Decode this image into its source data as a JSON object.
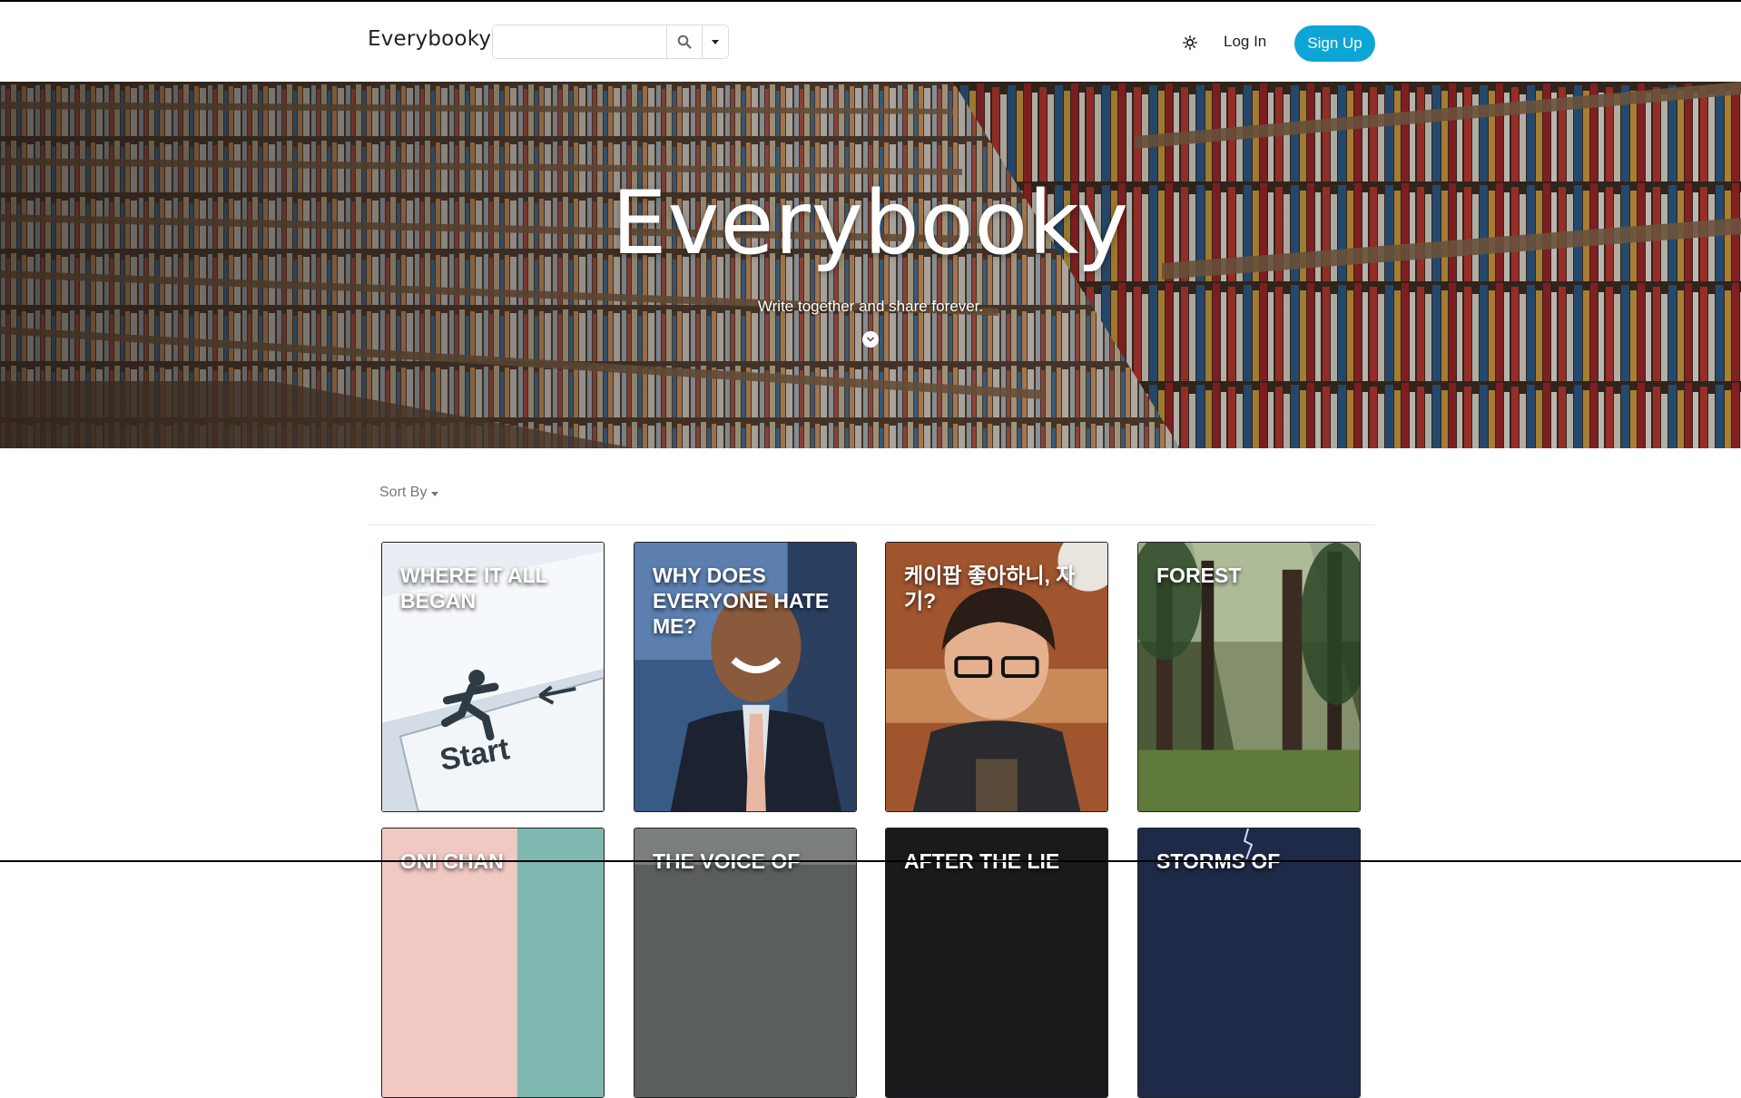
{
  "navbar": {
    "brand": "Everybooky",
    "search_value": "",
    "login_label": "Log In",
    "signup_label": "Sign Up"
  },
  "hero": {
    "title": "Everybooky",
    "subtitle": "Write together and share forever."
  },
  "sort": {
    "label": "Sort By"
  },
  "books": [
    {
      "title": "WHERE IT ALL BEGAN"
    },
    {
      "title": "WHY DOES EVERYONE HATE ME?"
    },
    {
      "title": "케이팝 좋아하니, 자기?"
    },
    {
      "title": "FOREST"
    },
    {
      "title": "ONI CHAN"
    },
    {
      "title": "THE VOICE OF"
    },
    {
      "title": "AFTER THE LIE"
    },
    {
      "title": "STORMS OF"
    }
  ],
  "colors": {
    "accent": "#0da5d6",
    "text": "#222222",
    "muted": "#777777"
  }
}
